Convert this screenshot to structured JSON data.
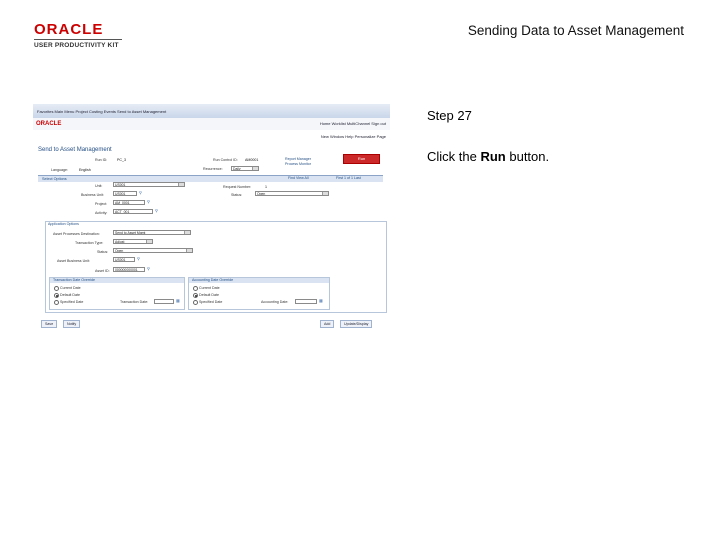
{
  "header": {
    "logo_text": "ORACLE",
    "logo_subtext": "USER PRODUCTIVITY KIT",
    "slide_title": "Sending Data to Asset Management"
  },
  "step": {
    "label": "Step 27",
    "instruction_prefix": "Click the ",
    "instruction_bold": "Run",
    "instruction_suffix": " button."
  },
  "screenshot": {
    "breadcrumb": "Favorites  Main Menu  Project Costing  Events  Send to Asset Management",
    "top_links": "Home   Worklist   MultiChannel   Sign out",
    "minilogo": "ORACLE",
    "nav_links": "New Window   Help   Personalize Page",
    "page_title": "Send to Asset Management",
    "fields": {
      "run_id_label": "Run ID:",
      "run_id_value": "PC_3",
      "run_control_label": "Run Control ID:",
      "run_control_value": "AM0001",
      "report_manager": "Report Manager",
      "process_monitor": "Process Monitor",
      "run_button": "Run",
      "language_label": "Language:",
      "language_value": "English",
      "recurrence_label": "Recurrence:",
      "recurrence_value": "Daily",
      "select_options": "Select Options",
      "unit_label": "Unit:",
      "unit_value": "US001",
      "request_number_label": "Request Number:",
      "request_number_value": "1",
      "business_unit_label": "Business Unit:",
      "business_unit_value": "US001",
      "project_label": "Project:",
      "project_value": "AM_0001",
      "activity_label": "Activity:",
      "activity_value": "ACT_001",
      "find": "Find   View All",
      "pager": "First   1 of 1   Last"
    },
    "app_options": {
      "header": "Application Options",
      "dest_label": "Asset Processes Destination:",
      "dest_value": "Send to Asset Mgmt",
      "trans_type_label": "Transaction Type:",
      "trans_type_value": "Adjust",
      "status_label": "Status:",
      "status_value": "Open",
      "asset_bu_label": "Asset Business Unit:",
      "asset_bu_value": "US001",
      "asset_id_label": "Asset ID:",
      "asset_id_value": "000000000001"
    },
    "trans_date": {
      "header": "Transaction Date Override",
      "opt1": "Current Date",
      "opt2": "Default Date",
      "opt3": "Specified Date",
      "field_label": "Transaction Date:"
    },
    "acct_date": {
      "header": "Accounting Date Override",
      "opt1": "Current Date",
      "opt2": "Default Date",
      "opt3": "Specified Date",
      "field_label": "Accounting Date:"
    },
    "bottom_buttons": {
      "save": "Save",
      "notify": "Notify",
      "add": "Add",
      "update": "Update/Display"
    }
  }
}
